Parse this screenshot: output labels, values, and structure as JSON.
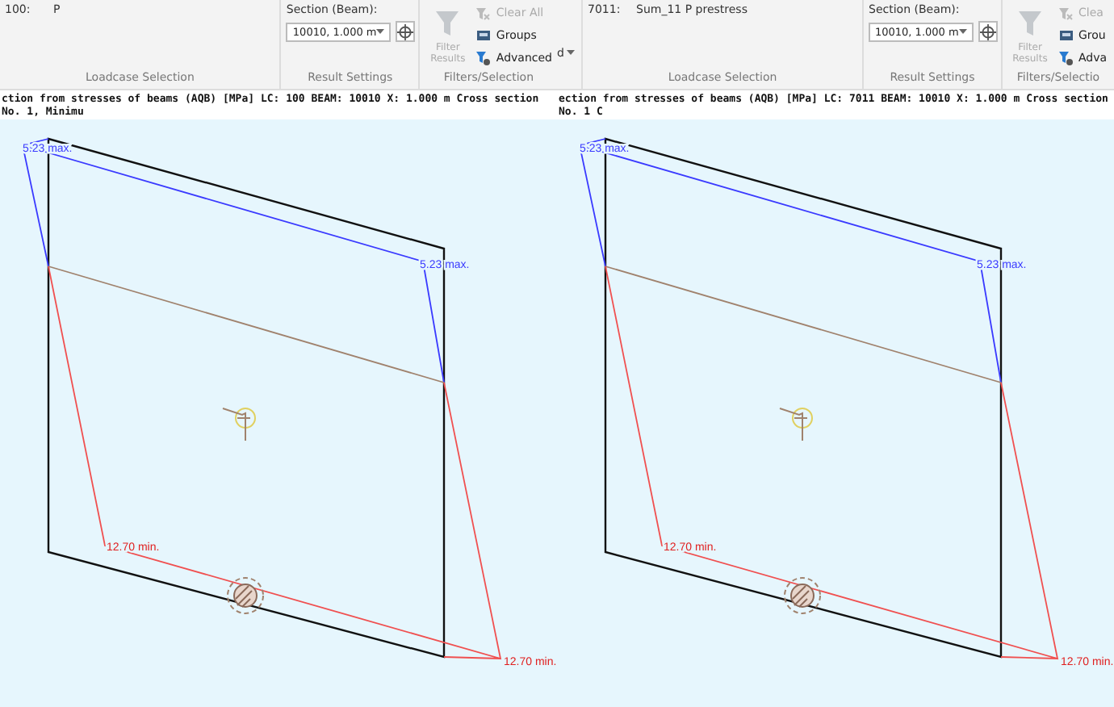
{
  "panels": [
    {
      "loadcase": {
        "number": "100:",
        "name": "P"
      },
      "loadcase_group": "Loadcase Selection",
      "section": {
        "label": "Section (Beam):",
        "value": "10010, 1.000 m"
      },
      "result_group": "Result Settings",
      "filter_button": {
        "label": "Filter Results",
        "disabled": true
      },
      "filter_items": [
        {
          "kind": "clear",
          "label": "Clear All",
          "disabled": true
        },
        {
          "kind": "groups",
          "label": "Groups",
          "disabled": false
        },
        {
          "kind": "advanced",
          "label": "Advanced",
          "disabled": false
        }
      ],
      "filter_group": "Filters/Selection",
      "title": "ction from stresses of beams (AQB) [MPa] LC: 100 BEAM: 10010 X: 1.000 m Cross section No. 1, Minimu",
      "labels": [
        "5.23 max.",
        "5.23 max.",
        "12.70 min.",
        "12.70 min."
      ]
    },
    {
      "cut_dropdown": "d",
      "loadcase": {
        "number": "7011:",
        "name": "Sum_11 P  prestress"
      },
      "loadcase_group": "Loadcase Selection",
      "section": {
        "label": "Section (Beam):",
        "value": "10010, 1.000 m"
      },
      "result_group": "Result Settings",
      "filter_button": {
        "label": "Filter Results",
        "disabled": true
      },
      "filter_items": [
        {
          "kind": "clear",
          "label": "Clea",
          "disabled": true
        },
        {
          "kind": "groups",
          "label": "Grou",
          "disabled": false
        },
        {
          "kind": "advanced",
          "label": "Adva",
          "disabled": false
        }
      ],
      "filter_group": "Filters/Selectio",
      "title": "ection from stresses of beams (AQB) [MPa] LC: 7011 BEAM: 10010 X: 1.000 m Cross section No. 1 C",
      "labels": [
        "5.23 max.",
        "5.23 max.",
        "12.70 min.",
        "12.70 min."
      ]
    }
  ]
}
